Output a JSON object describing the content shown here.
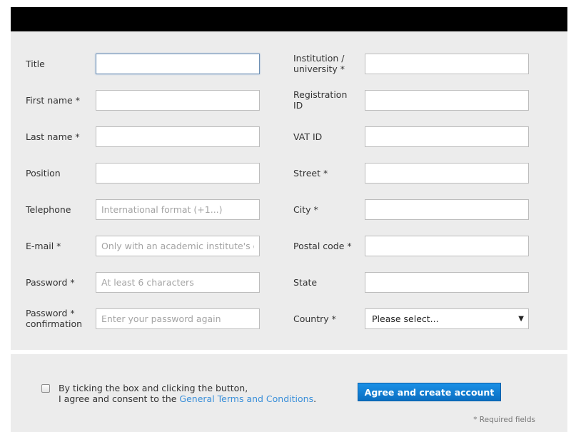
{
  "left_fields": [
    {
      "label": "Title",
      "value": "",
      "placeholder": ""
    },
    {
      "label": "First name *",
      "value": "",
      "placeholder": ""
    },
    {
      "label": "Last name *",
      "value": "",
      "placeholder": ""
    },
    {
      "label": "Position",
      "value": "",
      "placeholder": ""
    },
    {
      "label": "Telephone",
      "value": "",
      "placeholder": "International format (+1...)"
    },
    {
      "label": "E-mail *",
      "value": "",
      "placeholder": "Only with an academic institute's do"
    },
    {
      "label": "Password *",
      "value": "",
      "placeholder": "At least 6 characters"
    },
    {
      "label_line1": "Password *",
      "label_line2": "confirmation",
      "value": "",
      "placeholder": "Enter your password again"
    }
  ],
  "right_fields": [
    {
      "label_line1": "Institution /",
      "label_line2": "university *",
      "value": ""
    },
    {
      "label_line1": "Registration",
      "label_line2": "ID",
      "value": ""
    },
    {
      "label": "VAT ID",
      "value": ""
    },
    {
      "label": "Street *",
      "value": ""
    },
    {
      "label": "City *",
      "value": ""
    },
    {
      "label": "Postal code *",
      "value": ""
    },
    {
      "label": "State",
      "value": ""
    }
  ],
  "country": {
    "label": "Country *",
    "selected": "Please select..."
  },
  "consent": {
    "line1": "By ticking the box and clicking the button,",
    "line2_prefix": "I agree and consent to the ",
    "link": "General Terms and Conditions",
    "line2_suffix": "."
  },
  "submit_label": "Agree and create account",
  "required_note": "* Required fields"
}
